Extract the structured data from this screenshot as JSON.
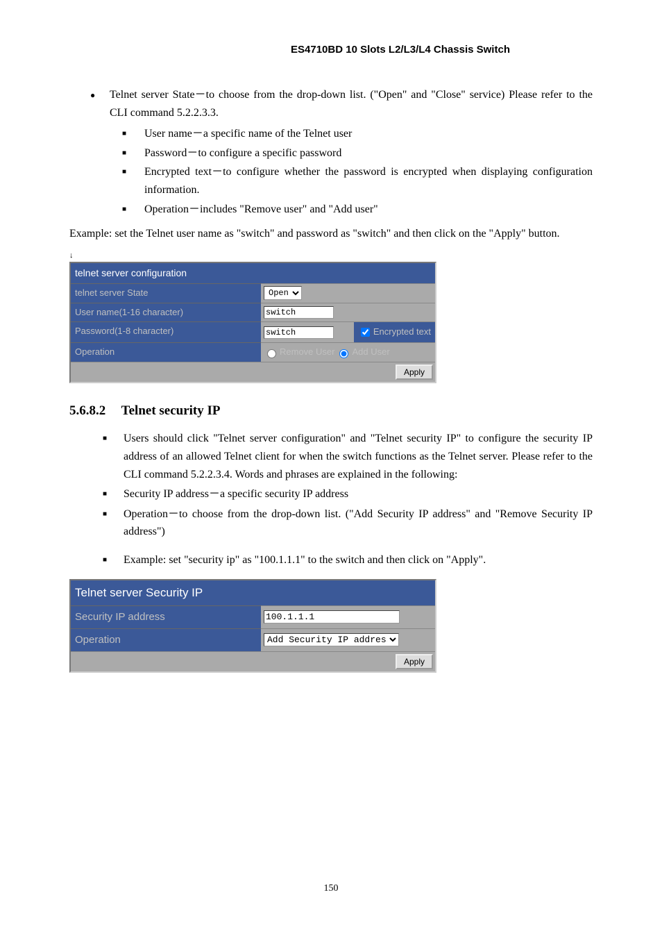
{
  "header": "ES4710BD 10 Slots L2/L3/L4 Chassis Switch",
  "top_bullet": "Telnet server State－to choose from the drop-down list. (\"Open\" and \"Close\" service) Please refer to the CLI command 5.2.2.3.3.",
  "sub_bullets": [
    "User name－a specific name of the Telnet user",
    "Password－to configure a specific password",
    "Encrypted text－to configure whether the password is encrypted when displaying configuration information.",
    "Operation－includes \"Remove user\" and \"Add user\""
  ],
  "example1": "Example: set the Telnet user name as \"switch\" and password as \"switch\" and then click on the \"Apply\" button.",
  "panel1": {
    "title": "telnet server configuration",
    "row1_label": "telnet server State",
    "row1_select": "Open",
    "row2_label": "User name(1-16 character)",
    "row2_value": "switch",
    "row3_label": "Password(1-8 character)",
    "row3_value": "switch",
    "row3_checkbox": "Encrypted text",
    "row4_label": "Operation",
    "row4_radio1": "Remove User",
    "row4_radio2": "Add User",
    "apply": "Apply"
  },
  "section": {
    "number": "5.6.8.2",
    "title": "Telnet security IP"
  },
  "section_bullets": [
    "Users should click \"Telnet server configuration\" and \"Telnet security IP\" to configure the security IP address of an allowed Telnet client for when the switch functions as the Telnet server. Please refer to the CLI command 5.2.2.3.4. Words and phrases are explained in the following:",
    "Security IP address－a specific security IP address",
    "Operation－to choose from the drop-down list. (\"Add Security IP address\" and \"Remove Security IP address\")"
  ],
  "example_bullet": "Example: set \"security ip\" as \"100.1.1.1\" to the switch and then click on \"Apply\".",
  "panel2": {
    "title": "Telnet server Security IP",
    "row1_label": "Security IP address",
    "row1_value": "100.1.1.1",
    "row2_label": "Operation",
    "row2_select": "Add Security IP address",
    "apply": "Apply"
  },
  "page_number": "150"
}
